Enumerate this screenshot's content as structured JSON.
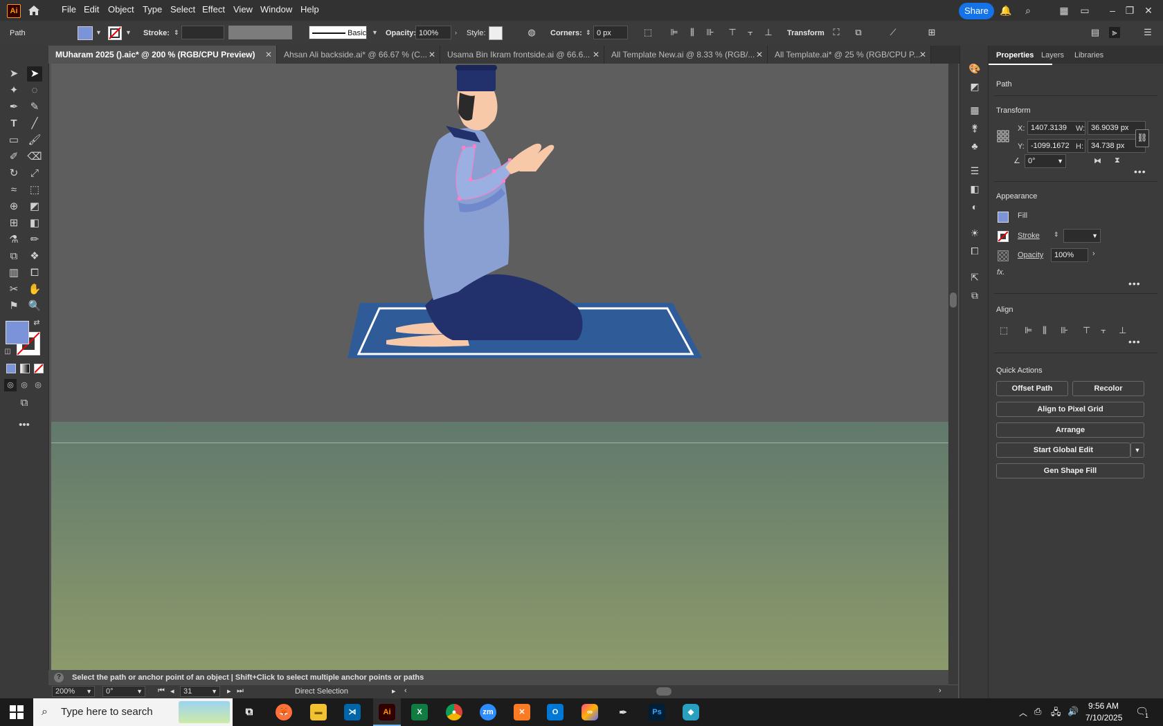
{
  "menubar": {
    "app_logo": "Ai",
    "items": [
      "File",
      "Edit",
      "Object",
      "Type",
      "Select",
      "Effect",
      "View",
      "Window",
      "Help"
    ],
    "share_label": "Share"
  },
  "controlbar": {
    "selection_type": "Path",
    "stroke_label": "Stroke:",
    "brush_label": "Basic",
    "opacity_label": "Opacity:",
    "opacity_value": "100%",
    "style_label": "Style:",
    "corners_label": "Corners:",
    "corners_value": "0 px",
    "transform_label": "Transform"
  },
  "tabs": [
    {
      "label": "MUharam 2025 ().aic* @ 200 % (RGB/CPU Preview)",
      "active": true
    },
    {
      "label": "Ahsan Ali backside.ai* @ 66.67 % (C...",
      "active": false
    },
    {
      "label": "Usama Bin Ikram frontside.ai @ 66.6...",
      "active": false
    },
    {
      "label": "All Template New.ai @ 8.33 % (RGB/...",
      "active": false
    },
    {
      "label": "All Template.ai* @ 25 % (RGB/CPU P...",
      "active": false
    }
  ],
  "status": {
    "hint": "Select the path or anchor point of an object  |  Shift+Click to select multiple anchor points or paths",
    "zoom": "200%",
    "rotation": "0°",
    "artboard_number": "31",
    "tool_name": "Direct Selection"
  },
  "panel": {
    "tabs": [
      "Properties",
      "Layers",
      "Libraries"
    ],
    "object_type": "Path",
    "transform_title": "Transform",
    "x_label": "X:",
    "x_value": "1407.3139",
    "y_label": "Y:",
    "y_value": "-1099.1672",
    "w_label": "W:",
    "w_value": "36.9039 px",
    "h_label": "H:",
    "h_value": "34.738 px",
    "angle_value": "0°",
    "appearance_title": "Appearance",
    "fill_label": "Fill",
    "stroke_label": "Stroke",
    "opacity_label": "Opacity",
    "opacity_value": "100%",
    "fx_label": "fx.",
    "align_title": "Align",
    "quick_actions_title": "Quick Actions",
    "quick_actions": {
      "offset_path": "Offset Path",
      "recolor": "Recolor",
      "align_pixel_grid": "Align to Pixel Grid",
      "arrange": "Arrange",
      "start_global_edit": "Start Global Edit",
      "gen_shape_fill": "Gen Shape Fill"
    }
  },
  "taskbar": {
    "search_placeholder": "Type here to search",
    "time": "9:56 AM",
    "date": "7/10/2025",
    "notification_count": "1",
    "app_labels": {
      "illustrator": "Ai",
      "excel": "X",
      "zoom": "zm",
      "photoshop": "Ps",
      "outlook": "O"
    }
  },
  "colors": {
    "accent": "#1473e6",
    "fill_swatch": "#7b93d9",
    "shirt": "#8aa0d3",
    "pants": "#22306b",
    "cap": "#22306b",
    "skin": "#f7c9a8",
    "rug": "#2f5c98"
  }
}
